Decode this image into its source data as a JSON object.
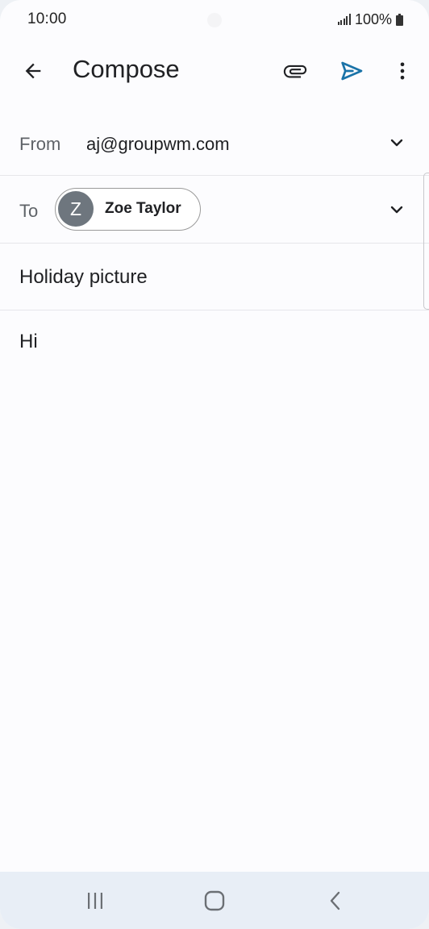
{
  "status_bar": {
    "time": "10:00",
    "battery": "100%",
    "icons": [
      "signal-icon",
      "battery-icon"
    ]
  },
  "app_bar": {
    "title": "Compose",
    "icons": [
      "back-arrow-icon",
      "paperclip-icon",
      "send-icon",
      "more-vert-icon"
    ]
  },
  "from": {
    "label": "From",
    "value": "aj@groupwm.com"
  },
  "to": {
    "label": "To",
    "recipients": [
      {
        "initial": "Z",
        "name": "Zoe Taylor"
      }
    ]
  },
  "subject": "Holiday picture",
  "body": "Hi",
  "nav_bar": {
    "icons": [
      "recents-icon",
      "home-icon",
      "nav-back-icon"
    ]
  },
  "colors": {
    "accent": "#1a73a8",
    "avatar": "#6e767e",
    "text": "#202124",
    "label": "#5f6368",
    "nav_bg": "#e8eef6"
  }
}
